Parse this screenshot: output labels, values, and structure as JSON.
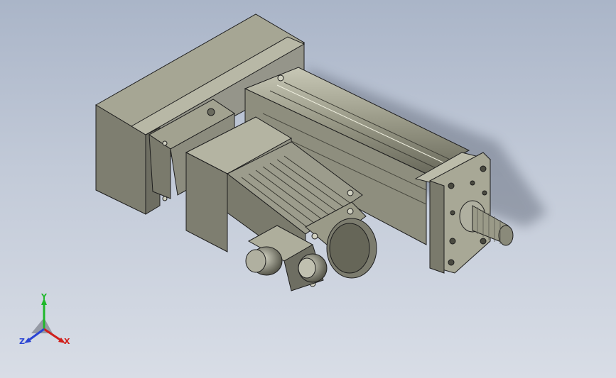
{
  "viewport": {
    "background_top": "#aab5c8",
    "background_bottom": "#d8dde6"
  },
  "model": {
    "description_icon": "servo-linear-actuator-icon",
    "body_color": "#8c8c7c",
    "body_light": "#b4b4a2",
    "body_dark": "#5e5e52",
    "edge_color": "#1e1e1e"
  },
  "triad": {
    "x_label": "X",
    "y_label": "Y",
    "z_label": "Z",
    "x_color": "#d0201c",
    "y_color": "#1fb82a",
    "z_color": "#2a44d4"
  }
}
